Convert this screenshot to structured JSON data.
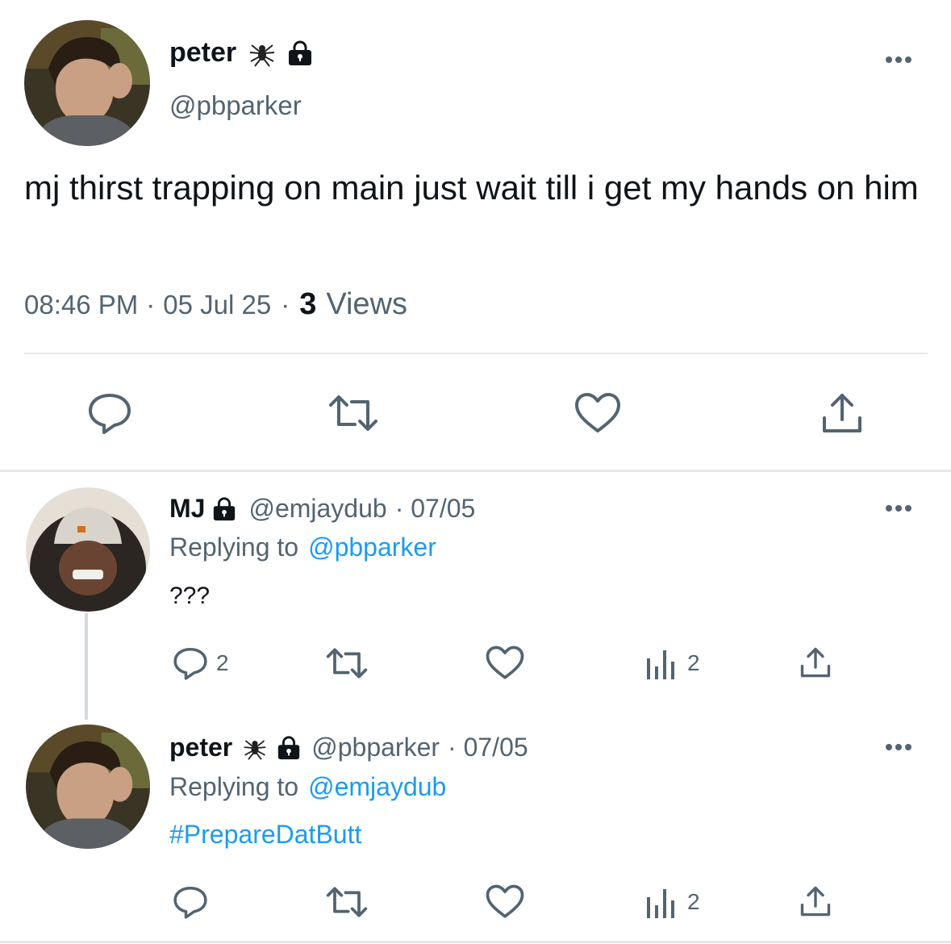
{
  "main_tweet": {
    "display_name": "peter",
    "handle": "@pbparker",
    "text": "mj thirst trapping on main just wait till i get my hands on him",
    "time": "08:46 PM",
    "date": "05 Jul 25",
    "views_count": "3",
    "views_label": "Views",
    "separator": "·"
  },
  "replies": [
    {
      "display_name": "MJ",
      "handle": "@emjaydub",
      "date": "· 07/05",
      "replying_prefix": "Replying to",
      "replying_handle": "@pbparker",
      "text": "???",
      "reply_count": "2",
      "views_count": "2"
    },
    {
      "display_name": "peter",
      "handle": "@pbparker",
      "date": "· 07/05",
      "replying_prefix": "Replying to",
      "replying_handle": "@emjaydub",
      "text": "#PrepareDatButt",
      "views_count": "2"
    }
  ],
  "colors": {
    "link": "#1d9bf0",
    "secondary": "#536471",
    "primary": "#0f1419",
    "divider": "#e6e9ec"
  }
}
